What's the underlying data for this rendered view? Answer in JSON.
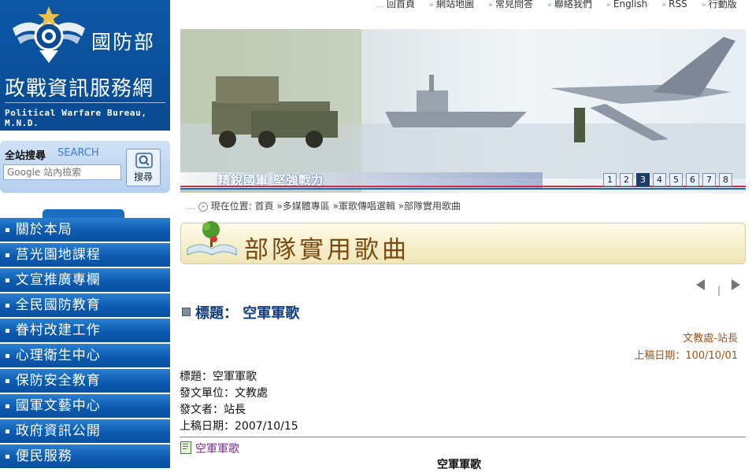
{
  "brand": {
    "mnd": "國防部",
    "bureau": "政戰資訊服務網",
    "bureau_en": "Political Warfare Bureau, M.N.D."
  },
  "search": {
    "label": "全站搜尋",
    "label_en": "SEARCH",
    "placeholder": "Google 站內檢索",
    "button": "搜尋"
  },
  "topnav": [
    "回首頁",
    "網站地圖",
    "常見問答",
    "聯絡我們",
    "English",
    "RSS",
    "行動版"
  ],
  "banner": {
    "caption": "精銳國軍 堅強戰力",
    "pages": [
      "1",
      "2",
      "3",
      "4",
      "5",
      "6",
      "7",
      "8"
    ],
    "active_page": "3"
  },
  "sidebar_nav": [
    "關於本局",
    "莒光園地課程",
    "文宣推廣專欄",
    "全民國防教育",
    "眷村改建工作",
    "心理衛生中心",
    "保防安全教育",
    "國軍文藝中心",
    "政府資訊公開",
    "便民服務"
  ],
  "breadcrumb": {
    "prefix": "現在位置:",
    "items": [
      "首頁",
      "»多媒體專區",
      "»軍歌傳唱選輯",
      "»部隊實用歌曲"
    ]
  },
  "page_title": "部隊實用歌曲",
  "pager_sep": "|",
  "article": {
    "heading": "標題：  空軍軍歌",
    "author": "文教處-站長",
    "date_line": "上稿日期：100/10/01",
    "meta": [
      "標題：空軍軍歌",
      "發文單位：文教處",
      "發文者：站長",
      "上稿日期：2007/10/15"
    ],
    "attachment": "空軍軍歌",
    "body_title": "空軍軍歌"
  },
  "colors": {
    "sidebar_blue": "#0c57a6",
    "title_brown": "#7a4a10",
    "heading_blue": "#123c7a",
    "accent_orange": "#a0541a"
  }
}
